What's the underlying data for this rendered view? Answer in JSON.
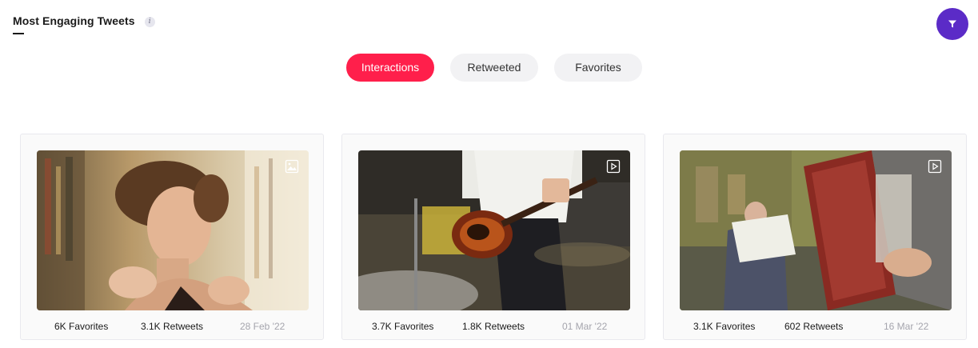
{
  "header": {
    "title": "Most Engaging Tweets",
    "info_glyph": "i"
  },
  "filter_icon": "filter-icon",
  "tabs": [
    {
      "label": "Interactions",
      "active": true,
      "color": "#ff1f4b"
    },
    {
      "label": "Retweeted",
      "active": false
    },
    {
      "label": "Favorites",
      "active": false
    }
  ],
  "tweets": [
    {
      "media_type": "image-icon",
      "favorites": "6K Favorites",
      "retweets": "3.1K Retweets",
      "date": "28 Feb '22"
    },
    {
      "media_type": "video-icon",
      "favorites": "3.7K Favorites",
      "retweets": "1.8K Retweets",
      "date": "01 Mar '22"
    },
    {
      "media_type": "video-icon",
      "favorites": "3.1K Favorites",
      "retweets": "602 Retweets",
      "date": "16 Mar '22"
    }
  ],
  "colors": {
    "accent": "#ff1f4b",
    "filter_button": "#5b2bc7",
    "date_text": "#a5a5ad"
  }
}
